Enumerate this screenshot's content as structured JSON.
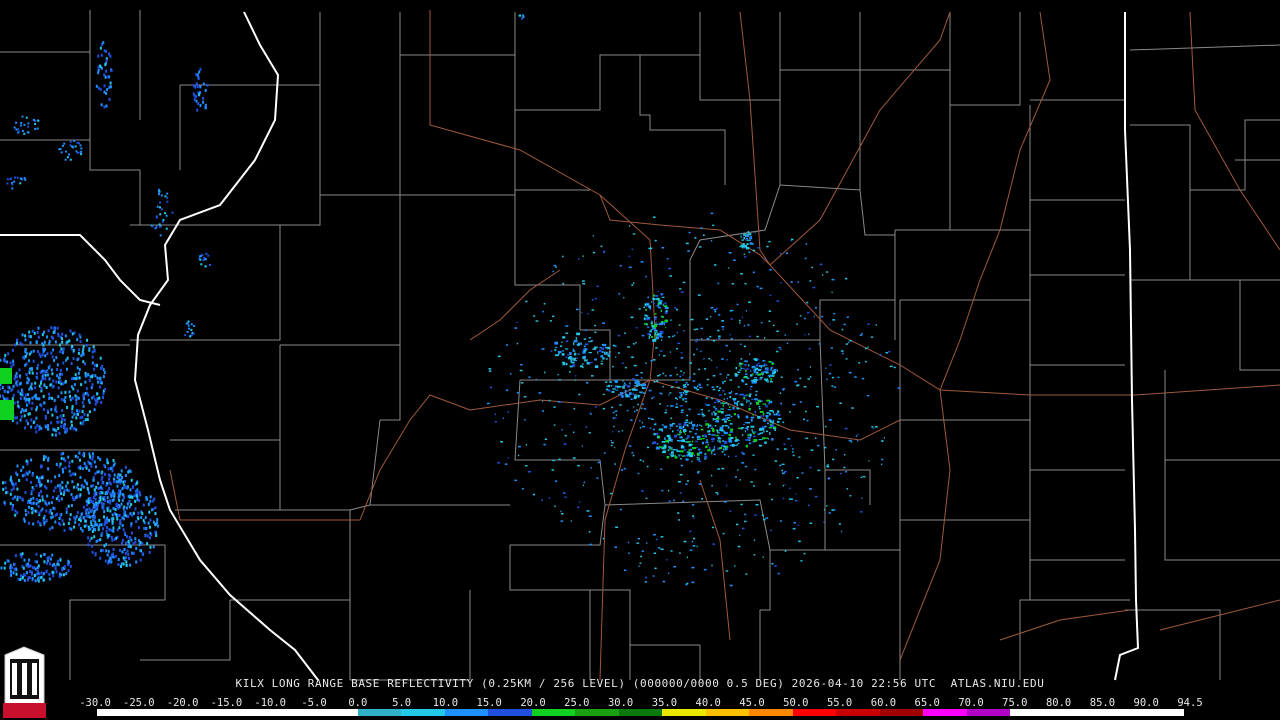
{
  "caption": "KILX LONG RANGE BASE REFLECTIVITY (0.25KM / 256 LEVEL) (000000/0000 0.5 DEG) 2026-04-10 22:56 UTC  ATLAS.NIU.EDU",
  "logo_text": "NIU",
  "scale": {
    "labels": [
      "-30.0",
      "-25.0",
      "-20.0",
      "-15.0",
      "-10.0",
      "-5.0",
      "0.0",
      "5.0",
      "10.0",
      "15.0",
      "20.0",
      "25.0",
      "30.0",
      "35.0",
      "40.0",
      "45.0",
      "50.0",
      "55.0",
      "60.0",
      "65.0",
      "70.0",
      "75.0",
      "80.0",
      "85.0",
      "90.0",
      "94.5"
    ],
    "colors": [
      "#ffffff",
      "#ffffff",
      "#ffffff",
      "#ffffff",
      "#ffffff",
      "#ffffff",
      "#2fb2c8",
      "#22c8e8",
      "#1e90ff",
      "#2050e0",
      "#10d020",
      "#1aa010",
      "#0a7a0a",
      "#e8e800",
      "#ffc000",
      "#ff8800",
      "#ff0000",
      "#c80000",
      "#a00000",
      "#ff00ff",
      "#b000c8",
      "#ffffff",
      "#ffffff",
      "#ffffff",
      "#ffffff"
    ]
  },
  "colors": {
    "background": "#000000",
    "county_lines": "#8a8a8a",
    "state_lines": "#ffffff",
    "highways": "#a05a3c"
  }
}
